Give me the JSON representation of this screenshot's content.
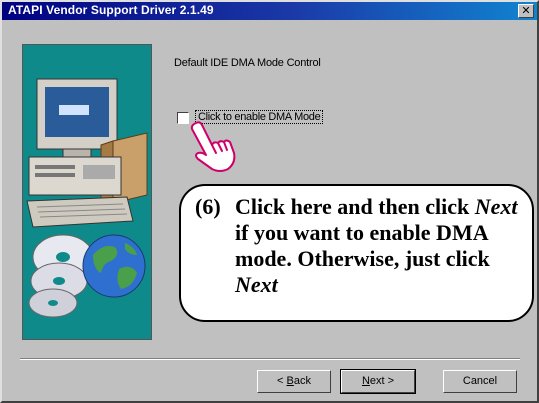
{
  "window": {
    "title": "ATAPI Vendor Support Driver 2.1.49",
    "close_glyph": "✕"
  },
  "main": {
    "heading": "Default IDE DMA Mode Control",
    "checkbox_label": "Click to enable DMA Mode",
    "checkbox_checked": false
  },
  "callout": {
    "number": "(6)",
    "text_1": "Click here and then click ",
    "next_1": "Next",
    "text_2": " if you want to enable DMA mode. Otherwise, just click ",
    "next_2": "Next"
  },
  "buttons": {
    "back_prefix": "< ",
    "back_u": "B",
    "back_rest": "ack",
    "next_u": "N",
    "next_rest": "ext >",
    "cancel": "Cancel"
  },
  "icons": [
    "close-icon",
    "computer-illustration-icon",
    "cd-discs-icon",
    "globe-icon",
    "pointing-hand-icon"
  ],
  "colors": {
    "title_bar": "#000080",
    "panel_teal": "#0f8a8a",
    "dialog_face": "#c0c0c0"
  }
}
